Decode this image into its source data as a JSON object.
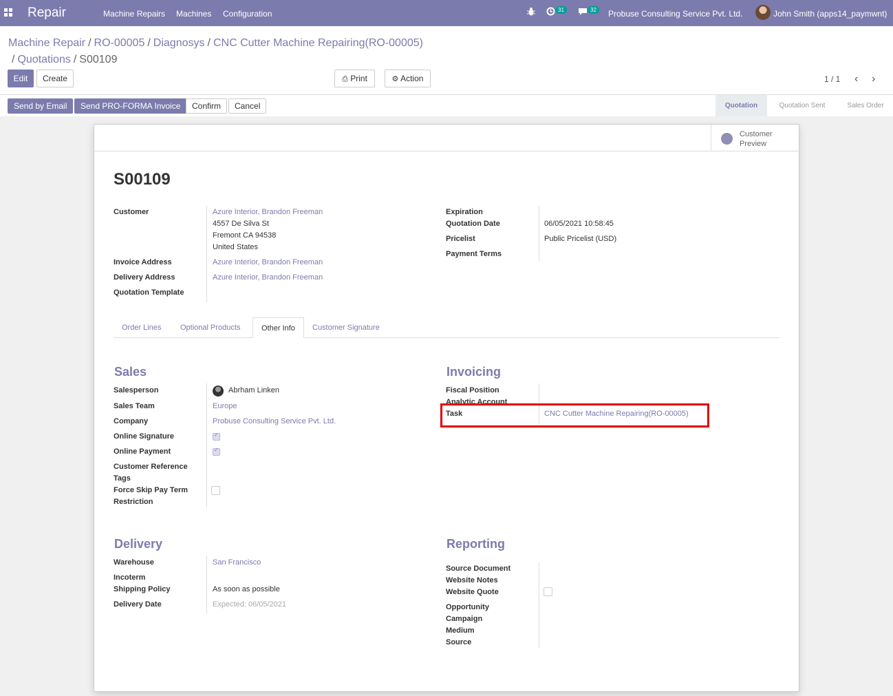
{
  "navbar": {
    "app_name": "Repair",
    "menu": [
      "Machine Repairs",
      "Machines",
      "Configuration"
    ],
    "activity_count": "31",
    "message_count": "32",
    "company": "Probuse Consulting Service Pvt. Ltd.",
    "user": "John Smith (apps14_paymwnt)"
  },
  "breadcrumb": [
    "Machine Repair",
    "RO-00005",
    "Diagnosys",
    "CNC Cutter Machine Repairing(RO-00005)",
    "Quotations"
  ],
  "breadcrumb_current": "S00109",
  "controls": {
    "edit": "Edit",
    "create": "Create",
    "print": "Print",
    "action": "Action",
    "pager": "1 / 1"
  },
  "status_buttons": {
    "send_email": "Send by Email",
    "send_proforma": "Send PRO-FORMA Invoice",
    "confirm": "Confirm",
    "cancel": "Cancel"
  },
  "stages": [
    "Quotation",
    "Quotation Sent",
    "Sales Order"
  ],
  "active_stage": "Quotation",
  "preview": {
    "line1": "Customer",
    "line2": "Preview"
  },
  "record": {
    "name": "S00109",
    "labels": {
      "customer": "Customer",
      "invoice_address": "Invoice Address",
      "delivery_address": "Delivery Address",
      "quotation_template": "Quotation Template",
      "expiration": "Expiration",
      "quotation_date": "Quotation Date",
      "pricelist": "Pricelist",
      "payment_terms": "Payment Terms"
    },
    "customer": "Azure Interior, Brandon Freeman",
    "customer_address": [
      "4557 De Silva St",
      "Fremont CA 94538",
      "United States"
    ],
    "invoice_address": "Azure Interior, Brandon Freeman",
    "delivery_address": "Azure Interior, Brandon Freeman",
    "quotation_date": "06/05/2021 10:58:45",
    "pricelist": "Public Pricelist (USD)"
  },
  "tabs": [
    "Order Lines",
    "Optional Products",
    "Other Info",
    "Customer Signature"
  ],
  "active_tab": "Other Info",
  "sales": {
    "title": "Sales",
    "labels": {
      "salesperson": "Salesperson",
      "sales_team": "Sales Team",
      "company": "Company",
      "online_signature": "Online Signature",
      "online_payment": "Online Payment",
      "customer_reference": "Customer Reference",
      "tags": "Tags",
      "force_skip_1": "Force Skip Pay Term",
      "force_skip_2": "Restriction"
    },
    "salesperson": "Abrham Linken",
    "sales_team": "Europe",
    "company": "Probuse Consulting Service Pvt. Ltd.",
    "online_signature": true,
    "online_payment": true,
    "force_skip": false
  },
  "invoicing": {
    "title": "Invoicing",
    "labels": {
      "fiscal_position": "Fiscal Position",
      "analytic_account": "Analytic Account",
      "task": "Task"
    },
    "task": "CNC Cutter Machine Repairing(RO-00005)"
  },
  "delivery": {
    "title": "Delivery",
    "labels": {
      "warehouse": "Warehouse",
      "incoterm": "Incoterm",
      "shipping_policy": "Shipping Policy",
      "delivery_date": "Delivery Date"
    },
    "warehouse": "San Francisco",
    "shipping_policy": "As soon as possible",
    "delivery_date": "Expected: 06/05/2021"
  },
  "reporting": {
    "title": "Reporting",
    "labels": {
      "source_document": "Source Document",
      "website_notes": "Website Notes",
      "website_quote": "Website Quote",
      "opportunity": "Opportunity",
      "campaign": "Campaign",
      "medium": "Medium",
      "source": "Source"
    },
    "website_quote": false
  },
  "colors": {
    "brand": "#7c7bad",
    "highlight": "#e00000",
    "badge": "#00a09d"
  }
}
